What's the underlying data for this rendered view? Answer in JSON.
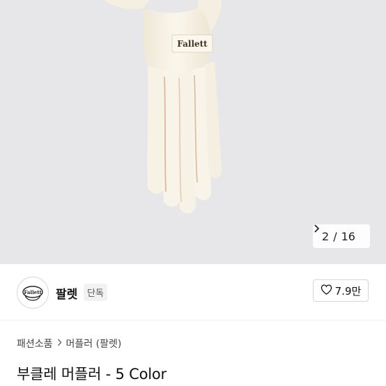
{
  "image_pager": {
    "current": "2",
    "separator": "/",
    "total": "16"
  },
  "brand": {
    "logo_text": "Fallett",
    "name": "팔렛",
    "tag": "단독"
  },
  "like": {
    "count": "7.9만"
  },
  "breadcrumb": {
    "items": [
      "패션소품",
      "머플러 (팔렛)"
    ]
  },
  "product": {
    "title": "부클레 머플러 - 5 Color",
    "label_text": "Fallett"
  },
  "colors": {
    "hero_bg": "#e7e7e9",
    "scarf": "#f7f1e4",
    "stripe": "#d9a47c"
  }
}
